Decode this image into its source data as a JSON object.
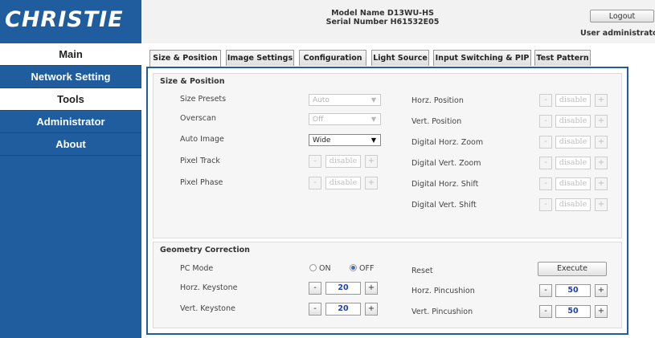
{
  "brand": {
    "logo_text": "CHRISTIE"
  },
  "header": {
    "model": "Model Name D13WU-HS",
    "serial": "Serial Number H61532E05",
    "logout_label": "Logout",
    "user": "User administrato"
  },
  "sidebar": {
    "items": [
      {
        "label": "Main",
        "active": true
      },
      {
        "label": "Network Setting",
        "active": false
      },
      {
        "label": "Tools",
        "active": true
      },
      {
        "label": "Administrator",
        "active": false
      },
      {
        "label": "About",
        "active": false
      }
    ]
  },
  "tabs": [
    {
      "label": "Size & Position",
      "active": true
    },
    {
      "label": "Image Settings",
      "active": false
    },
    {
      "label": "Configuration",
      "active": false
    },
    {
      "label": "Light Source",
      "active": false
    },
    {
      "label": "Input Switching & PIP",
      "active": false
    },
    {
      "label": "Test Pattern",
      "active": false
    }
  ],
  "size_position": {
    "title": "Size & Position",
    "left": [
      {
        "label": "Size Presets",
        "control": "select",
        "value": "Auto",
        "enabled": false
      },
      {
        "label": "Overscan",
        "control": "select",
        "value": "Off",
        "enabled": false
      },
      {
        "label": "Auto Image",
        "control": "select",
        "value": "Wide",
        "enabled": true
      },
      {
        "label": "Pixel Track",
        "control": "stepper",
        "value": "disable",
        "enabled": false
      },
      {
        "label": "Pixel Phase",
        "control": "stepper",
        "value": "disable",
        "enabled": false
      }
    ],
    "right": [
      {
        "label": "Horz. Position",
        "value": "disable"
      },
      {
        "label": "Vert. Position",
        "value": "disable"
      },
      {
        "label": "Digital Horz. Zoom",
        "value": "disable"
      },
      {
        "label": "Digital Vert. Zoom",
        "value": "disable"
      },
      {
        "label": "Digital Horz. Shift",
        "value": "disable"
      },
      {
        "label": "Digital Vert. Shift",
        "value": "disable"
      }
    ]
  },
  "geometry": {
    "title": "Geometry Correction",
    "pc_mode": {
      "label": "PC Mode",
      "on_label": "ON",
      "off_label": "OFF",
      "selected": "OFF"
    },
    "reset": {
      "label": "Reset",
      "button": "Execute"
    },
    "horz_keystone": {
      "label": "Horz. Keystone",
      "value": "20"
    },
    "vert_keystone": {
      "label": "Vert. Keystone",
      "value": "20"
    },
    "horz_pincushion": {
      "label": "Horz. Pincushion",
      "value": "50"
    },
    "vert_pincushion": {
      "label": "Vert. Pincushion",
      "value": "50"
    }
  },
  "icons": {
    "minus": "-",
    "plus": "+",
    "dropdown": "▼"
  }
}
